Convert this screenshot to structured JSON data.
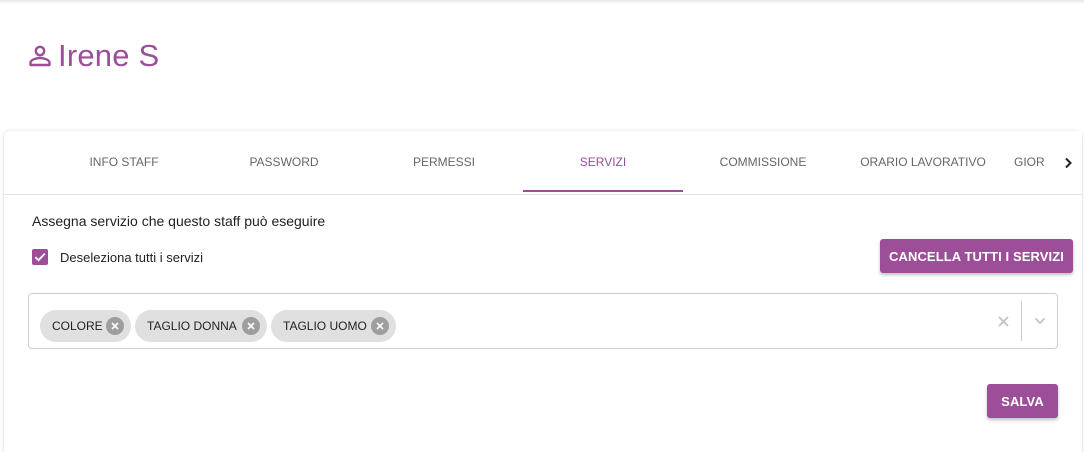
{
  "header": {
    "title": "Irene S",
    "icon": "user-icon"
  },
  "tabs": [
    {
      "label": "INFO STAFF",
      "active": false
    },
    {
      "label": "PASSWORD",
      "active": false
    },
    {
      "label": "PERMESSI",
      "active": false
    },
    {
      "label": "SERVIZI",
      "active": true
    },
    {
      "label": "COMMISSIONE",
      "active": false
    },
    {
      "label": "ORARIO LAVORATIVO",
      "active": false
    },
    {
      "label": "GIOR",
      "active": false
    }
  ],
  "services": {
    "section_label": "Assegna servizio che questo staff può eseguire",
    "checkbox_label": "Deseleziona tutti i servizi",
    "checkbox_checked": true,
    "clear_all_label": "CANCELLA TUTTI I SERVIZI",
    "selected": [
      {
        "label": "COLORE"
      },
      {
        "label": "TAGLIO DONNA"
      },
      {
        "label": "TAGLIO UOMO"
      }
    ],
    "save_label": "SALVA"
  },
  "colors": {
    "accent": "#9c4e98",
    "chip": "#e0e0e0",
    "chip_remove": "#9e9e9e"
  }
}
